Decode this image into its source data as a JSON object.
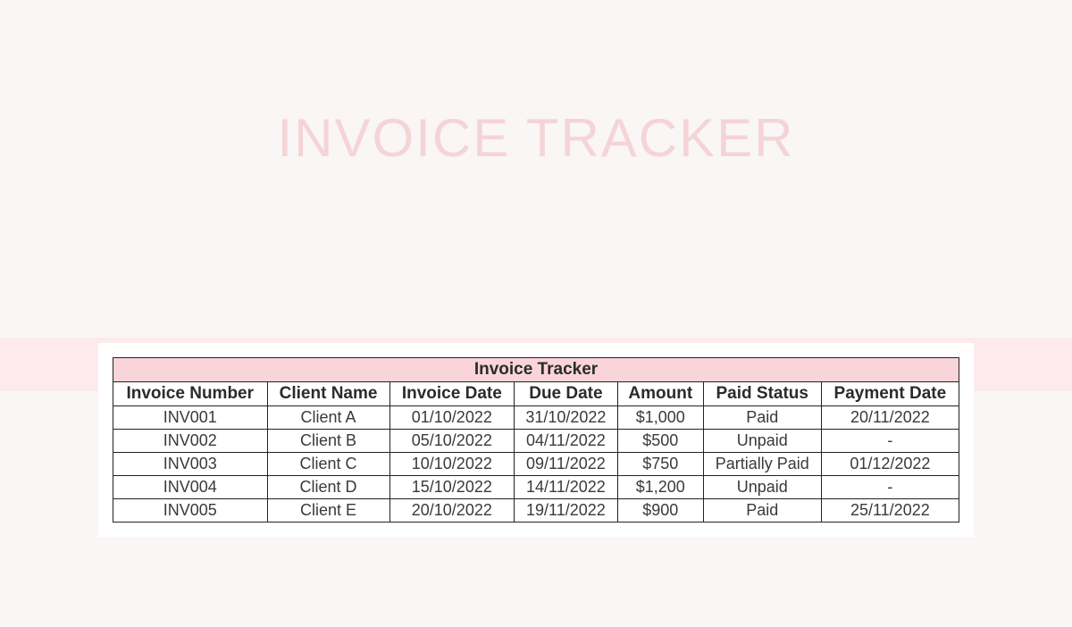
{
  "title": "INVOICE TRACKER",
  "table": {
    "header_title": "Invoice Tracker",
    "columns": [
      "Invoice Number",
      "Client Name",
      "Invoice Date",
      "Due Date",
      "Amount",
      "Paid Status",
      "Payment Date"
    ],
    "rows": [
      {
        "invoice_number": "INV001",
        "client_name": "Client A",
        "invoice_date": "01/10/2022",
        "due_date": "31/10/2022",
        "amount": "$1,000",
        "paid_status": "Paid",
        "payment_date": "20/11/2022"
      },
      {
        "invoice_number": "INV002",
        "client_name": "Client B",
        "invoice_date": "05/10/2022",
        "due_date": "04/11/2022",
        "amount": "$500",
        "paid_status": "Unpaid",
        "payment_date": "-"
      },
      {
        "invoice_number": "INV003",
        "client_name": "Client C",
        "invoice_date": "10/10/2022",
        "due_date": "09/11/2022",
        "amount": "$750",
        "paid_status": "Partially Paid",
        "payment_date": "01/12/2022"
      },
      {
        "invoice_number": "INV004",
        "client_name": "Client D",
        "invoice_date": "15/10/2022",
        "due_date": "14/11/2022",
        "amount": "$1,200",
        "paid_status": "Unpaid",
        "payment_date": "-"
      },
      {
        "invoice_number": "INV005",
        "client_name": "Client E",
        "invoice_date": "20/10/2022",
        "due_date": "19/11/2022",
        "amount": "$900",
        "paid_status": "Paid",
        "payment_date": "25/11/2022"
      }
    ]
  }
}
